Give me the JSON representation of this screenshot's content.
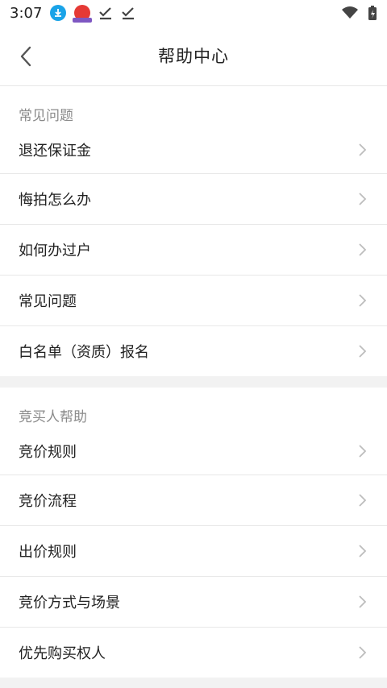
{
  "status_bar": {
    "time": "3:07",
    "icons": [
      "download-icon",
      "app-notification-icon",
      "check-icon",
      "check-icon",
      "wifi-icon",
      "battery-charging-icon"
    ]
  },
  "header": {
    "title": "帮助中心",
    "back_icon": "chevron-left-icon"
  },
  "sections": [
    {
      "title": "常见问题",
      "items": [
        "退还保证金",
        "悔拍怎么办",
        "如何办过户",
        "常见问题",
        "白名单（资质）报名"
      ]
    },
    {
      "title": "竞买人帮助",
      "items": [
        "竞价规则",
        "竞价流程",
        "出价规则",
        "竞价方式与场景",
        "优先购买权人"
      ]
    }
  ],
  "colors": {
    "accent_download": "#1aa3e8",
    "text_primary": "#222222",
    "text_secondary": "#8a8a8a",
    "divider": "#e8e8e8",
    "background": "#f2f2f2"
  }
}
